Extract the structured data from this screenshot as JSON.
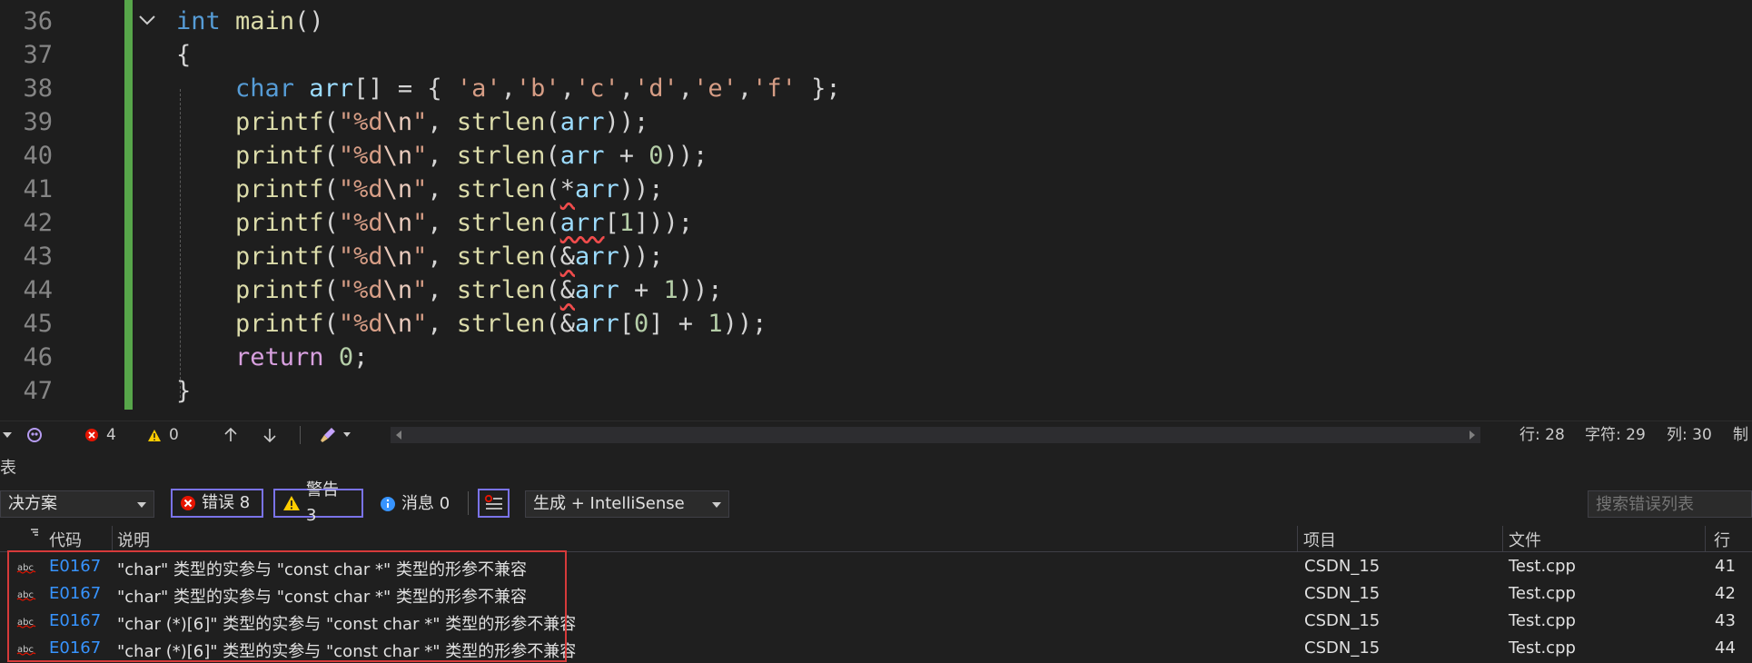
{
  "editor": {
    "line_numbers": [
      "36",
      "37",
      "38",
      "39",
      "40",
      "41",
      "42",
      "43",
      "44",
      "45",
      "46",
      "47"
    ]
  },
  "status": {
    "errors": "4",
    "warnings": "0",
    "row": "行: 28",
    "char": "字符: 29",
    "col": "列: 30",
    "tab": "制"
  },
  "panel": {
    "title": "表",
    "scope": "决方案",
    "errors_btn": "错误 8",
    "warnings_btn": "警告 3",
    "messages_btn": "消息 0",
    "build_filter": "生成 + IntelliSense",
    "search_placeholder": "搜索错误列表",
    "columns": {
      "code": "代码",
      "desc": "说明",
      "project": "项目",
      "file": "文件",
      "line": "行"
    },
    "rows": [
      {
        "code": "E0167",
        "desc": "\"char\" 类型的实参与 \"const char *\" 类型的形参不兼容",
        "project": "CSDN_15",
        "file": "Test.cpp",
        "line": "41"
      },
      {
        "code": "E0167",
        "desc": "\"char\" 类型的实参与 \"const char *\" 类型的形参不兼容",
        "project": "CSDN_15",
        "file": "Test.cpp",
        "line": "42"
      },
      {
        "code": "E0167",
        "desc": "\"char (*)[6]\" 类型的实参与 \"const char *\" 类型的形参不兼容",
        "project": "CSDN_15",
        "file": "Test.cpp",
        "line": "43"
      },
      {
        "code": "E0167",
        "desc": "\"char (*)[6]\" 类型的实参与 \"const char *\" 类型的形参不兼容",
        "project": "CSDN_15",
        "file": "Test.cpp",
        "line": "44"
      }
    ]
  },
  "code": {
    "l36": {
      "kw": "int",
      "fn": "main",
      "p": "()"
    },
    "l37": {
      "p": "{"
    },
    "l38": {
      "kw": "char",
      "var": "arr",
      "p1": "[] = { ",
      "s1": "'a'",
      "c1": ",",
      "s2": "'b'",
      "c2": ",",
      "s3": "'c'",
      "c3": ",",
      "s4": "'d'",
      "c4": ",",
      "s5": "'e'",
      "c5": ",",
      "s6": "'f'",
      "p2": " };"
    },
    "printf": "printf",
    "strlen": "strlen",
    "fmt_open": "\"%d",
    "fmt_esc": "\\n",
    "fmt_close": "\"",
    "l39": {
      "args": "arr",
      "tail": "));"
    },
    "l40": {
      "args": "arr",
      "op": " + ",
      "num": "0",
      "tail": "));"
    },
    "l41": {
      "star": "*",
      "args": "arr",
      "tail": "));"
    },
    "l42": {
      "args": "arr",
      "open": "[",
      "num": "1",
      "close": "]",
      "tail": "));"
    },
    "l43": {
      "amp": "&",
      "args": "arr",
      "tail": "));"
    },
    "l44": {
      "amp": "&",
      "args": "arr",
      "op": " + ",
      "num": "1",
      "tail": "));"
    },
    "l45": {
      "amp": "&",
      "args": "arr",
      "open": "[",
      "num0": "0",
      "close": "]",
      "op": " + ",
      "num": "1",
      "tail": "));"
    },
    "l46": {
      "ctl": "return",
      "num": "0",
      "tail": ";"
    },
    "l47": {
      "p": "}"
    }
  }
}
